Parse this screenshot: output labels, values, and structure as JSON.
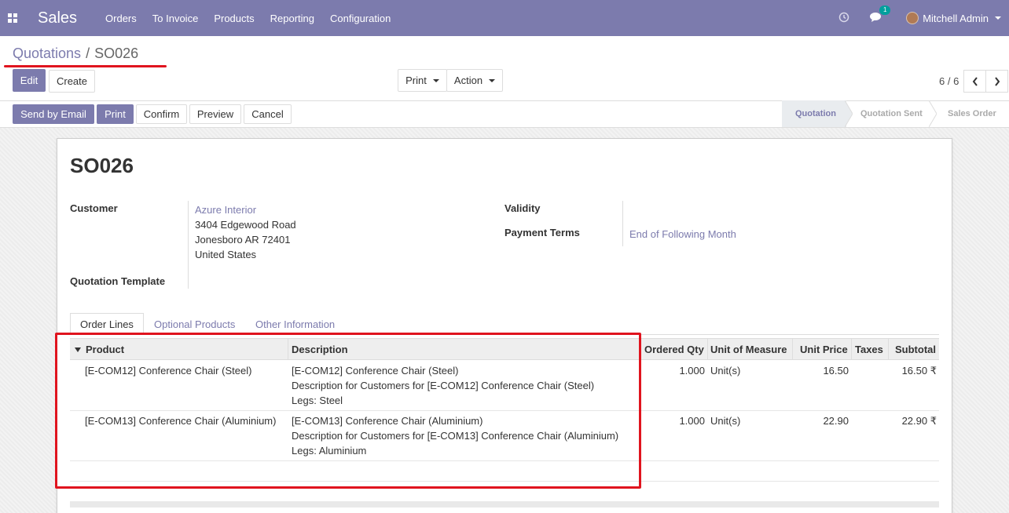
{
  "app": {
    "name": "Sales"
  },
  "nav": {
    "menu": [
      "Orders",
      "To Invoice",
      "Products",
      "Reporting",
      "Configuration"
    ],
    "chat_count": "1",
    "user": "Mitchell Admin"
  },
  "breadcrumb": {
    "parent": "Quotations",
    "separator": "/",
    "current": "SO026"
  },
  "toolbar": {
    "edit": "Edit",
    "create": "Create",
    "print": "Print",
    "action": "Action"
  },
  "pager": {
    "value": "6 / 6"
  },
  "status_buttons": {
    "send_email": "Send by Email",
    "print": "Print",
    "confirm": "Confirm",
    "preview": "Preview",
    "cancel": "Cancel"
  },
  "stages": [
    "Quotation",
    "Quotation Sent",
    "Sales Order"
  ],
  "record": {
    "name": "SO026",
    "customer_label": "Customer",
    "customer_name": "Azure Interior",
    "address": [
      "3404 Edgewood Road",
      "Jonesboro AR 72401",
      "United States"
    ],
    "template_label": "Quotation Template",
    "validity_label": "Validity",
    "payment_terms_label": "Payment Terms",
    "payment_terms": "End of Following Month"
  },
  "tabs": [
    "Order Lines",
    "Optional Products",
    "Other Information"
  ],
  "table": {
    "columns": [
      "Product",
      "Description",
      "Ordered Qty",
      "Unit of Measure",
      "Unit Price",
      "Taxes",
      "Subtotal"
    ],
    "rows": [
      {
        "product": "[E-COM12] Conference Chair (Steel)",
        "description": [
          "[E-COM12] Conference Chair (Steel)",
          "Description for Customers for [E-COM12] Conference Chair (Steel)",
          "Legs: Steel"
        ],
        "qty": "1.000",
        "uom": "Unit(s)",
        "price": "16.50",
        "taxes": "",
        "subtotal": "16.50 ₹"
      },
      {
        "product": "[E-COM13] Conference Chair (Aluminium)",
        "description": [
          "[E-COM13] Conference Chair (Aluminium)",
          "Description for Customers for [E-COM13] Conference Chair (Aluminium)",
          "Legs: Aluminium"
        ],
        "qty": "1.000",
        "uom": "Unit(s)",
        "price": "22.90",
        "taxes": "",
        "subtotal": "22.90 ₹"
      }
    ]
  },
  "colors": {
    "brand": "#7c7bad",
    "highlight": "#e0141e",
    "badge": "#00a09d"
  }
}
